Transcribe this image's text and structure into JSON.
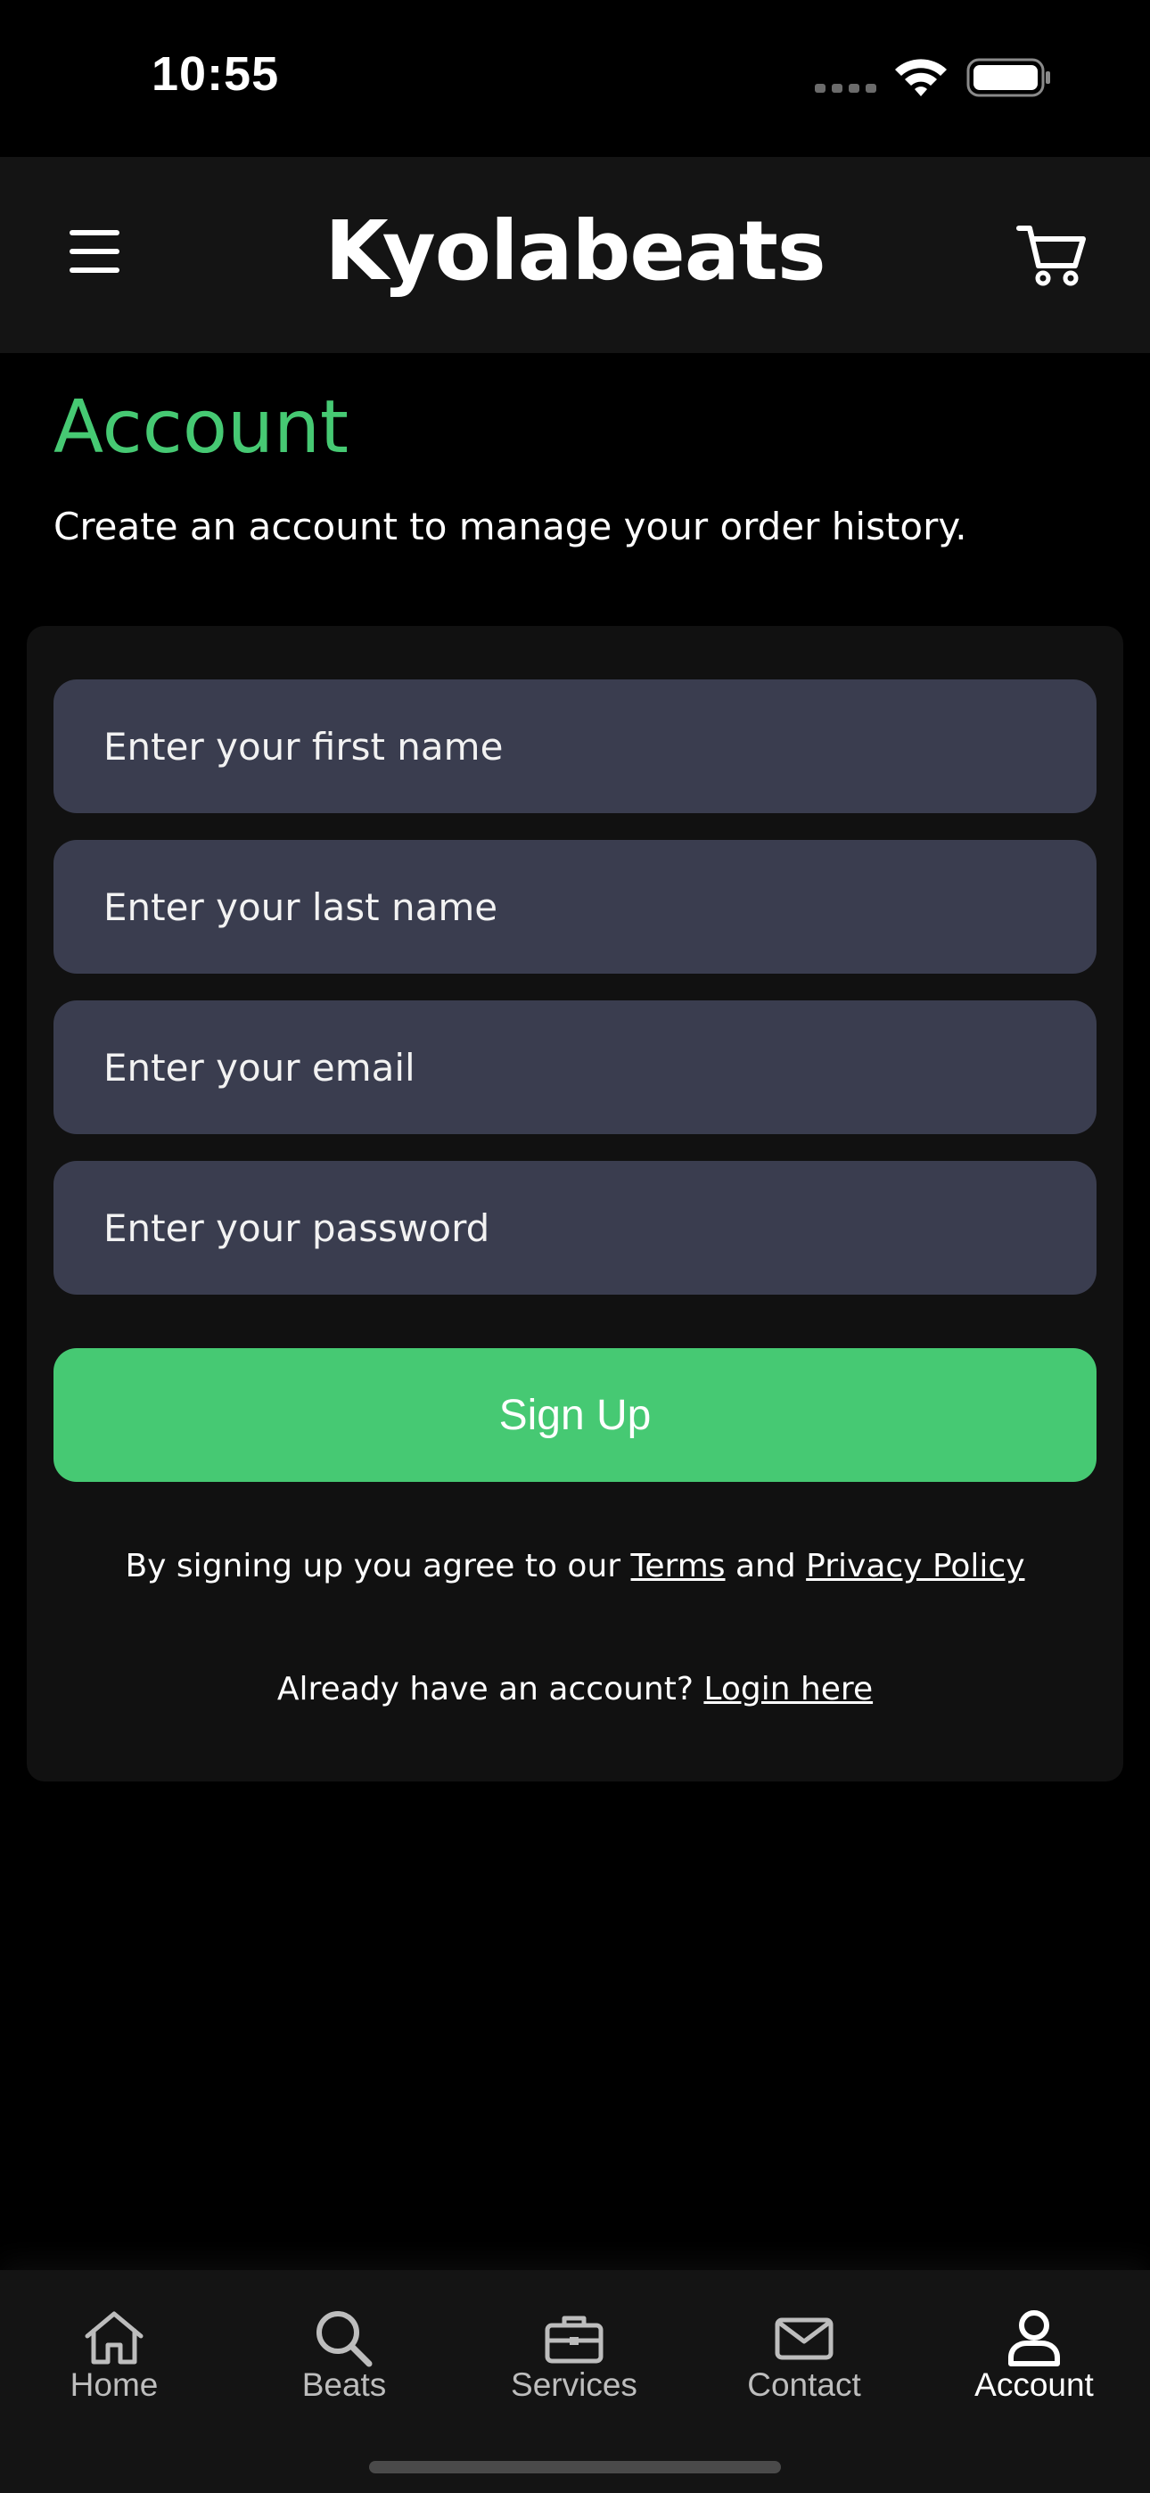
{
  "status_bar": {
    "time": "10:55"
  },
  "header": {
    "title": "Kyolabeats",
    "menu_icon": "hamburger-menu-icon",
    "cart_icon": "shopping-cart-icon"
  },
  "page": {
    "title": "Account",
    "subtitle": "Create an account to manage your order history."
  },
  "form": {
    "first_name_placeholder": "Enter your first name",
    "last_name_placeholder": "Enter your last name",
    "email_placeholder": "Enter your email",
    "password_placeholder": "Enter your password",
    "submit_label": "Sign Up",
    "terms_prefix": "By signing up you agree to our ",
    "terms_link": "Terms",
    "terms_and": " and ",
    "privacy_link": "Privacy Policy",
    "login_prefix": "Already have an account? ",
    "login_link": "Login here"
  },
  "tabs": [
    {
      "label": "Home",
      "icon": "home-icon",
      "active": false
    },
    {
      "label": "Beats",
      "icon": "search-icon",
      "active": false
    },
    {
      "label": "Services",
      "icon": "briefcase-icon",
      "active": false
    },
    {
      "label": "Contact",
      "icon": "mail-icon",
      "active": false
    },
    {
      "label": "Account",
      "icon": "user-icon",
      "active": true
    }
  ],
  "colors": {
    "accent": "#46c973",
    "background": "#000000",
    "header": "#141414",
    "card": "#111111",
    "input": "#3a3d4f"
  }
}
